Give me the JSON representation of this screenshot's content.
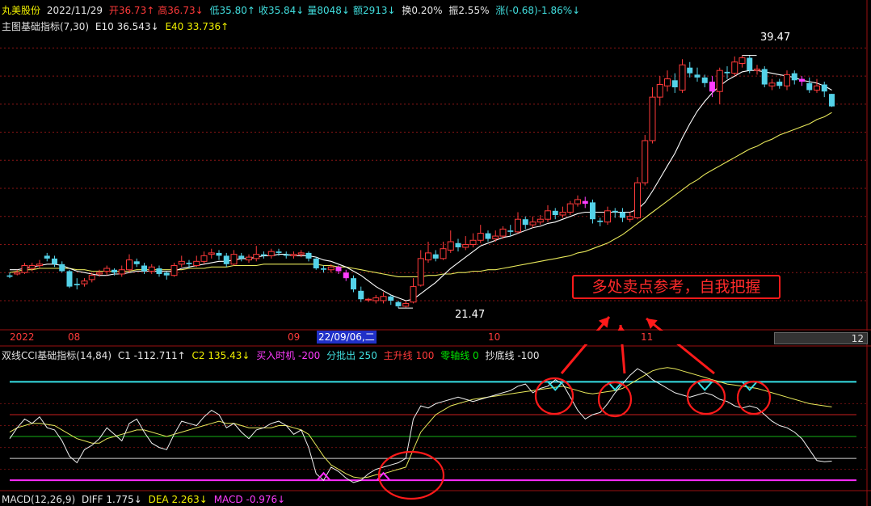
{
  "header": {
    "stock_name": "丸美股份",
    "date": "2022/11/29",
    "open": "开36.73↑",
    "high": "高36.73↓",
    "low": "低35.80↑",
    "close": "收35.84↓",
    "volume": "量8048↓",
    "amount": "额2913↓",
    "turnover": "换0.20%",
    "amplitude": "振2.55%",
    "change": "涨(-0.68)-1.86%↓"
  },
  "main_indicator": {
    "name": "主图基础指标(7,30)",
    "e10": "E10 36.543↓",
    "e40": "E40 33.736↑"
  },
  "price_labels": {
    "high": "39.47",
    "low": "21.47"
  },
  "date_axis": {
    "labels": [
      "2022",
      "08",
      "09",
      "10",
      "11"
    ],
    "highlight": "22/09/06,二",
    "scroll_num": "12"
  },
  "callout": "多处卖点参考，自我把握",
  "cci": {
    "name": "双线CCI基础指标(14,84)",
    "c1": "C1 -112.711↑",
    "c2": "C2 135.43↓",
    "buy": "买入时机 -200",
    "sell": "分批出 250",
    "main_up": "主升线 100",
    "zero": "零轴线 0",
    "bottom": "抄底线 -100"
  },
  "macd": {
    "name": "MACD(12,26,9)",
    "diff": "DIFF 1.775↓",
    "dea": "DEA 2.263↓",
    "macd": "MACD -0.976↓"
  },
  "colors": {
    "up": "#ff3a3a",
    "down": "#54d2e8",
    "special": "#ff3cff",
    "e10": "#ffffff",
    "e40": "#e8e85a"
  },
  "chart_data": {
    "type": "candlestick",
    "ylim": [
      20.5,
      41.0
    ],
    "candles": [
      [
        23.8,
        23.7,
        24.0,
        23.6
      ],
      [
        23.9,
        24.0,
        24.2,
        23.8
      ],
      [
        24.0,
        24.5,
        24.7,
        23.9
      ],
      [
        24.3,
        24.5,
        24.7,
        24.1
      ],
      [
        24.5,
        24.6,
        24.9,
        24.3
      ],
      [
        25.2,
        25.0,
        25.4,
        24.8
      ],
      [
        25.0,
        24.6,
        25.2,
        24.4
      ],
      [
        24.6,
        24.1,
        24.8,
        24.0
      ],
      [
        24.1,
        23.0,
        24.2,
        22.9
      ],
      [
        23.2,
        23.1,
        23.6,
        22.8
      ],
      [
        23.2,
        23.4,
        23.6,
        23.0
      ],
      [
        23.5,
        23.8,
        24.0,
        23.3
      ],
      [
        23.9,
        24.0,
        24.2,
        23.7
      ],
      [
        24.1,
        24.3,
        24.5,
        23.8
      ],
      [
        24.2,
        24.0,
        24.3,
        23.8
      ],
      [
        23.9,
        24.2,
        24.5,
        23.7
      ],
      [
        24.2,
        24.9,
        25.3,
        24.0
      ],
      [
        24.8,
        24.6,
        25.0,
        24.4
      ],
      [
        24.5,
        24.1,
        24.7,
        23.9
      ],
      [
        24.1,
        24.4,
        24.6,
        23.9
      ],
      [
        24.3,
        23.9,
        24.5,
        23.7
      ],
      [
        24.0,
        23.8,
        24.1,
        23.5
      ],
      [
        23.8,
        24.5,
        24.7,
        23.7
      ],
      [
        24.6,
        24.8,
        25.2,
        24.4
      ],
      [
        24.7,
        24.6,
        24.9,
        24.3
      ],
      [
        24.5,
        24.8,
        25.2,
        24.4
      ],
      [
        24.8,
        25.2,
        25.5,
        24.6
      ],
      [
        25.3,
        25.4,
        25.7,
        25.0
      ],
      [
        25.4,
        25.2,
        25.6,
        24.9
      ],
      [
        25.2,
        24.6,
        25.4,
        24.4
      ],
      [
        24.6,
        25.3,
        25.6,
        24.5
      ],
      [
        25.2,
        25.0,
        25.4,
        24.8
      ],
      [
        24.9,
        25.1,
        25.3,
        24.7
      ],
      [
        25.0,
        25.3,
        25.9,
        24.8
      ],
      [
        25.3,
        25.2,
        25.5,
        25.0
      ],
      [
        25.2,
        25.5,
        25.7,
        25.0
      ],
      [
        25.5,
        25.4,
        25.7,
        25.2
      ],
      [
        25.3,
        25.2,
        25.5,
        25.0
      ],
      [
        25.2,
        25.3,
        25.5,
        25.0
      ],
      [
        25.3,
        25.4,
        25.6,
        25.1
      ],
      [
        25.4,
        25.0,
        25.5,
        24.8
      ],
      [
        25.0,
        24.3,
        25.1,
        24.2
      ],
      [
        24.3,
        24.2,
        24.5,
        24.0
      ],
      [
        24.2,
        24.4,
        24.6,
        24.0
      ],
      [
        24.4,
        24.1,
        24.5,
        23.9
      ],
      [
        24.0,
        23.6,
        24.2,
        23.4
      ],
      [
        23.6,
        22.8,
        23.8,
        22.6
      ],
      [
        22.7,
        22.1,
        23.0,
        21.9
      ],
      [
        22.1,
        22.1,
        22.2,
        21.9
      ],
      [
        22.0,
        22.2,
        22.4,
        21.8
      ],
      [
        22.0,
        22.3,
        22.6,
        21.8
      ],
      [
        22.3,
        22.0,
        22.4,
        21.7
      ],
      [
        21.9,
        21.6,
        22.0,
        21.47
      ],
      [
        21.6,
        21.8,
        22.0,
        21.5
      ],
      [
        21.9,
        23.0,
        23.6,
        21.8
      ],
      [
        23.1,
        25.0,
        25.6,
        23.0
      ],
      [
        24.9,
        25.4,
        26.2,
        24.7
      ],
      [
        25.3,
        25.0,
        25.6,
        24.8
      ],
      [
        25.0,
        25.7,
        26.2,
        24.9
      ],
      [
        25.6,
        26.2,
        27.0,
        25.4
      ],
      [
        26.1,
        25.8,
        26.4,
        25.5
      ],
      [
        25.8,
        26.0,
        26.6,
        25.6
      ],
      [
        26.0,
        26.3,
        26.8,
        25.8
      ],
      [
        26.3,
        26.8,
        27.4,
        26.1
      ],
      [
        26.8,
        26.4,
        27.0,
        26.2
      ],
      [
        26.4,
        26.6,
        27.0,
        26.2
      ],
      [
        26.6,
        27.1,
        27.3,
        26.4
      ],
      [
        27.0,
        26.9,
        27.4,
        26.6
      ],
      [
        26.9,
        27.8,
        28.3,
        26.8
      ],
      [
        27.8,
        27.4,
        28.0,
        27.1
      ],
      [
        27.4,
        27.6,
        28.0,
        27.2
      ],
      [
        27.6,
        27.8,
        28.1,
        27.4
      ],
      [
        27.8,
        28.4,
        28.8,
        27.6
      ],
      [
        28.4,
        28.1,
        28.6,
        27.8
      ],
      [
        28.1,
        28.3,
        28.7,
        27.9
      ],
      [
        28.3,
        28.9,
        29.1,
        28.1
      ],
      [
        28.9,
        29.2,
        29.5,
        28.7
      ],
      [
        29.1,
        28.9,
        29.4,
        28.6
      ],
      [
        29.0,
        27.8,
        29.2,
        27.5
      ],
      [
        27.7,
        27.6,
        27.9,
        27.3
      ],
      [
        27.6,
        28.4,
        28.7,
        27.4
      ],
      [
        28.4,
        28.3,
        28.6,
        27.9
      ],
      [
        28.3,
        27.9,
        28.6,
        27.6
      ],
      [
        27.8,
        28.0,
        28.3,
        27.6
      ],
      [
        27.9,
        30.4,
        30.8,
        27.8
      ],
      [
        30.4,
        33.4,
        33.8,
        30.2
      ],
      [
        33.4,
        36.5,
        37.2,
        33.2
      ],
      [
        36.5,
        37.4,
        38.0,
        35.9
      ],
      [
        37.3,
        37.8,
        38.4,
        36.9
      ],
      [
        37.7,
        37.2,
        38.2,
        36.8
      ],
      [
        37.0,
        38.8,
        39.2,
        36.8
      ],
      [
        38.6,
        38.2,
        39.0,
        37.9
      ],
      [
        38.1,
        37.9,
        38.6,
        37.6
      ],
      [
        37.9,
        37.5,
        38.1,
        37.2
      ],
      [
        37.6,
        36.9,
        38.0,
        36.5
      ],
      [
        36.9,
        38.4,
        38.6,
        36.0
      ],
      [
        38.3,
        38.2,
        38.7,
        37.8
      ],
      [
        38.2,
        39.0,
        39.4,
        38.0
      ],
      [
        38.9,
        39.3,
        39.47,
        38.6
      ],
      [
        39.3,
        38.4,
        39.5,
        38.2
      ],
      [
        38.4,
        38.5,
        38.8,
        38.1
      ],
      [
        38.5,
        37.4,
        38.7,
        37.2
      ],
      [
        37.3,
        37.5,
        37.8,
        37.0
      ],
      [
        37.6,
        37.3,
        37.8,
        37.1
      ],
      [
        37.3,
        38.1,
        38.4,
        37.0
      ],
      [
        38.2,
        37.7,
        38.4,
        37.4
      ],
      [
        37.8,
        37.6,
        38.0,
        37.3
      ],
      [
        37.5,
        37.0,
        37.9,
        36.8
      ],
      [
        37.0,
        37.3,
        37.8,
        36.8
      ],
      [
        37.4,
        36.9,
        37.6,
        36.5
      ],
      [
        36.73,
        35.84,
        36.73,
        35.8
      ]
    ],
    "special_candles": [
      44,
      45,
      77,
      94,
      106
    ],
    "e10": [
      24.2,
      24.2,
      24.3,
      24.4,
      24.5,
      24.6,
      24.6,
      24.5,
      24.3,
      24.1,
      24.0,
      23.9,
      23.8,
      23.8,
      23.9,
      23.9,
      24.0,
      24.1,
      24.1,
      24.1,
      24.1,
      24.1,
      24.1,
      24.3,
      24.4,
      24.5,
      24.6,
      24.7,
      24.8,
      24.8,
      24.9,
      25.0,
      25.0,
      25.1,
      25.2,
      25.2,
      25.3,
      25.3,
      25.2,
      25.2,
      25.2,
      25.1,
      24.9,
      24.8,
      24.6,
      24.4,
      24.1,
      23.8,
      23.4,
      23.0,
      22.7,
      22.4,
      22.2,
      22.0,
      22.1,
      22.5,
      22.9,
      23.3,
      23.8,
      24.3,
      24.7,
      25.1,
      25.5,
      25.9,
      26.1,
      26.3,
      26.5,
      26.6,
      26.8,
      27.0,
      27.2,
      27.3,
      27.5,
      27.6,
      27.8,
      28.0,
      28.2,
      28.3,
      28.3,
      28.3,
      28.3,
      28.3,
      28.3,
      28.3,
      28.5,
      29.0,
      29.8,
      30.7,
      31.6,
      32.5,
      33.6,
      34.6,
      35.5,
      36.2,
      36.8,
      37.3,
      37.7,
      38.0,
      38.3,
      38.4,
      38.4,
      38.3,
      38.2,
      38.1,
      38.0,
      37.9,
      37.7,
      37.6,
      37.5,
      37.3,
      37.0
    ],
    "e40": [
      24.0,
      24.1,
      24.2,
      24.2,
      24.3,
      24.3,
      24.3,
      24.3,
      24.3,
      24.2,
      24.2,
      24.1,
      24.1,
      24.1,
      24.1,
      24.1,
      24.1,
      24.2,
      24.2,
      24.2,
      24.2,
      24.2,
      24.2,
      24.2,
      24.3,
      24.3,
      24.3,
      24.4,
      24.4,
      24.4,
      24.5,
      24.5,
      24.5,
      24.5,
      24.6,
      24.6,
      24.6,
      24.6,
      24.6,
      24.6,
      24.6,
      24.6,
      24.5,
      24.5,
      24.4,
      24.4,
      24.3,
      24.2,
      24.1,
      24.0,
      23.9,
      23.8,
      23.7,
      23.7,
      23.7,
      23.7,
      23.8,
      23.8,
      23.9,
      23.9,
      24.0,
      24.0,
      24.1,
      24.1,
      24.2,
      24.2,
      24.3,
      24.4,
      24.5,
      24.6,
      24.7,
      24.8,
      24.9,
      25.0,
      25.1,
      25.2,
      25.4,
      25.5,
      25.7,
      25.9,
      26.1,
      26.4,
      26.7,
      27.1,
      27.5,
      27.9,
      28.3,
      28.7,
      29.1,
      29.5,
      29.9,
      30.3,
      30.6,
      31.0,
      31.3,
      31.6,
      31.9,
      32.2,
      32.5,
      32.8,
      33.0,
      33.3,
      33.5,
      33.8,
      34.0,
      34.2,
      34.4,
      34.6,
      34.9,
      35.1,
      35.4
    ],
    "cci_ylim": [
      -240,
      340
    ],
    "cci_levels": {
      "sell": 250,
      "main_up": 100,
      "zero": 0,
      "bottom": -100,
      "buy": -200
    },
    "cci_c1": [
      -10,
      40,
      80,
      60,
      90,
      40,
      30,
      -20,
      -90,
      -120,
      -60,
      -40,
      -10,
      40,
      10,
      -20,
      60,
      80,
      20,
      -30,
      -50,
      -60,
      10,
      70,
      60,
      50,
      90,
      120,
      100,
      40,
      60,
      20,
      -10,
      30,
      40,
      60,
      70,
      50,
      10,
      30,
      -50,
      -170,
      -200,
      -140,
      -160,
      -190,
      -210,
      -200,
      -170,
      -150,
      -140,
      -130,
      -120,
      -100,
      80,
      140,
      130,
      150,
      160,
      170,
      180,
      170,
      160,
      170,
      180,
      190,
      200,
      210,
      230,
      240,
      200,
      220,
      230,
      260,
      240,
      180,
      120,
      80,
      100,
      110,
      150,
      200,
      240,
      280,
      310,
      290,
      260,
      240,
      220,
      200,
      190,
      180,
      190,
      200,
      190,
      170,
      160,
      140,
      130,
      140,
      130,
      100,
      70,
      50,
      40,
      20,
      -10,
      -60,
      -110,
      -115,
      -112.711
    ],
    "cci_c2": [
      20,
      40,
      50,
      60,
      60,
      55,
      50,
      30,
      10,
      -10,
      -20,
      -30,
      -30,
      -10,
      0,
      10,
      20,
      30,
      30,
      20,
      10,
      0,
      10,
      20,
      30,
      40,
      50,
      60,
      70,
      60,
      60,
      50,
      40,
      40,
      40,
      40,
      50,
      50,
      40,
      30,
      10,
      -40,
      -90,
      -130,
      -150,
      -170,
      -185,
      -190,
      -185,
      -175,
      -170,
      -160,
      -150,
      -140,
      -60,
      20,
      60,
      100,
      120,
      140,
      150,
      160,
      170,
      175,
      180,
      185,
      190,
      195,
      200,
      205,
      210,
      215,
      220,
      225,
      230,
      220,
      210,
      200,
      195,
      200,
      205,
      210,
      220,
      240,
      260,
      280,
      300,
      310,
      315,
      310,
      300,
      290,
      280,
      270,
      260,
      250,
      240,
      235,
      230,
      225,
      220,
      210,
      200,
      190,
      180,
      170,
      160,
      150,
      145,
      140,
      135.43
    ],
    "cci_buy_signals": [
      42,
      50
    ]
  }
}
